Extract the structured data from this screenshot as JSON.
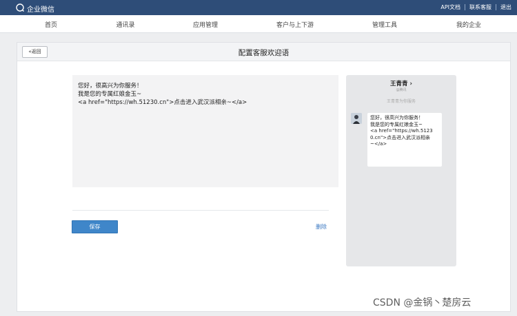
{
  "topbar": {
    "brand": "企业微信",
    "links": [
      "API文档",
      "联系客服",
      "退出"
    ]
  },
  "nav": {
    "items": [
      "首页",
      "通讯录",
      "应用管理",
      "客户与上下游",
      "管理工具",
      "我的企业"
    ]
  },
  "page": {
    "back_label": "«返回",
    "title": "配置客服欢迎语"
  },
  "editor": {
    "lines": [
      "您好，很高兴为你服务！",
      "我是您的专属红娘金玉~",
      "",
      "<a href=\"https://wh.51230.cn\">点击进入武汉派相亲~</a>"
    ]
  },
  "actions": {
    "save_label": "保存",
    "delete_label": "删除"
  },
  "preview": {
    "name": "王青青 ›",
    "sub": "@腾讯",
    "note": "王青青为你服务",
    "bubble_lines": [
      "您好，很高兴为你服务！",
      "我是您的专属红娘金玉~",
      "",
      "<a href=\"https://wh.5123",
      "0.cn\">点击进入武汉派相亲",
      "~</a>"
    ]
  },
  "watermark": "CSDN @金锅丶楚房云"
}
